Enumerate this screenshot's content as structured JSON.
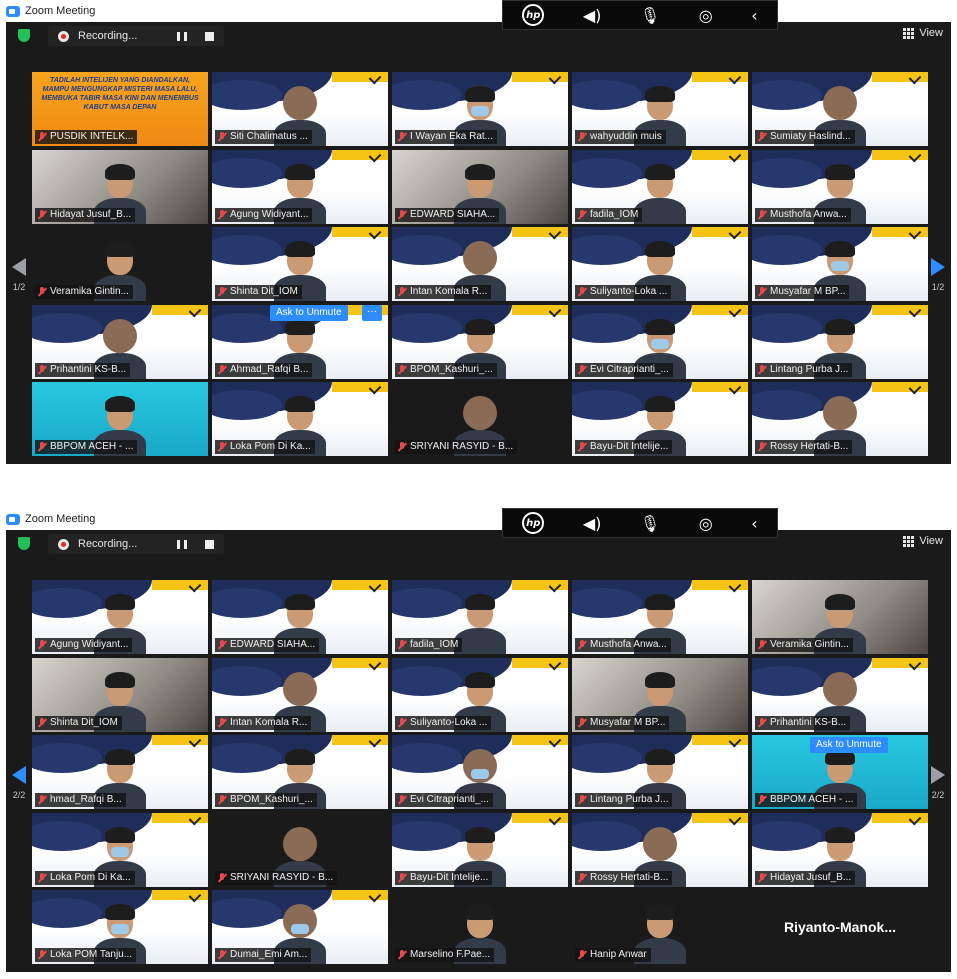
{
  "app": {
    "title": "Zoom Meeting",
    "recording_label": "Recording...",
    "view_label": "View"
  },
  "hp_toolbar": {
    "logo": "hp",
    "icons": [
      "speaker-icon",
      "microphone-icon",
      "broadcast-icon",
      "back-arrow-icon"
    ]
  },
  "colors": {
    "accent": "#2D8CFF",
    "muted_icon": "#e5484d",
    "workshop_navy": "#1f2d5a",
    "workshop_yellow": "#f5c414",
    "active_speaker": "#f0e44a"
  },
  "shot1": {
    "page_left": "1/2",
    "page_right": "1/2",
    "ask_to_unmute": "Ask to Unmute",
    "more": "···",
    "banner_text": "TADILAH INTELIJEN YANG DIANDALKAN, MAMPU MENGUNGKAP MISTERI MASA LALU, MEMBUKA TABIR MASA KINI DAN MENEMBUS KABUT MASA DEPAN",
    "tiles": [
      "PUSDIK INTELK...",
      "Siti Chalimatus ...",
      "I Wayan Eka Rat...",
      "wahyuddin muis",
      "Sumiaty Haslind...",
      "Hidayat Jusuf_B...",
      "Agung Widiyant...",
      "EDWARD SIAHA...",
      "fadila_IOM",
      "Musthofa Anwa...",
      "Veramika Gintin...",
      "Shinta Dit_IOM",
      "Intan Komala R...",
      "Suliyanto-Loka ...",
      "Musyafar M BP...",
      "Prihantini KS-B...",
      "Ahmad_Rafqi B...",
      "BPOM_Kashuri_...",
      "Evi Citraprianti_...",
      "Lintang Purba J...",
      "BBPOM ACEH - ...",
      "Loka Pom Di Ka...",
      "SRIYANI RASYID - B...",
      "Bayu-Dit Intelije...",
      "Rossy Hertati-B..."
    ]
  },
  "shot2": {
    "page_left": "2/2",
    "page_right": "2/2",
    "ask_to_unmute": "Ask to Unmute",
    "name_only": "Riyanto-Manok...",
    "tiles": [
      "Agung Widiyant...",
      "EDWARD SIAHA...",
      "fadila_IOM",
      "Musthofa Anwa...",
      "Veramika Gintin...",
      "Shinta Dit_IOM",
      "Intan Komala R...",
      "Suliyanto-Loka ...",
      "Musyafar M BP...",
      "Prihantini KS-B...",
      "hmad_Rafqi B...",
      "BPOM_Kashuri_...",
      "Evi Citraprianti_...",
      "Lintang Purba J...",
      "BBPOM ACEH - ...",
      "Loka Pom Di Ka...",
      "SRIYANI RASYID - B...",
      "Bayu-Dit Intelije...",
      "Rossy Hertati-B...",
      "Hidayat Jusuf_B...",
      "Loka POM Tanju...",
      "Dumai_Emi Am...",
      "Marselino F.Pae...",
      "Hanip Anwar"
    ]
  }
}
